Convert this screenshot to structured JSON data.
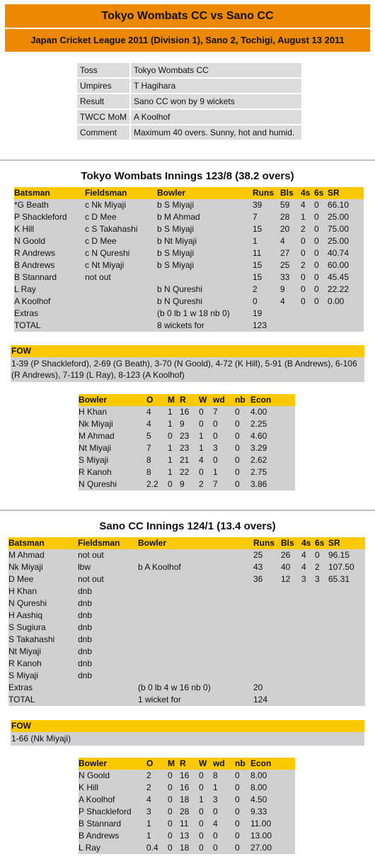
{
  "header": {
    "title": "Tokyo Wombats CC vs Sano CC",
    "subtitle": "Japan Cricket League 2011 (Division 1), Sano 2, Tochigi, August 13 2011"
  },
  "match_info": [
    {
      "key": "Toss",
      "value": "Tokyo Wombats CC"
    },
    {
      "key": "Umpires",
      "value": "T Hagihara"
    },
    {
      "key": "Result",
      "value": "Sano CC won by 9 wickets"
    },
    {
      "key": "TWCC MoM",
      "value": "A Koolhof"
    },
    {
      "key": "Comment",
      "value": "Maximum 40 overs. Sunny, hot and humid."
    }
  ],
  "colors": {
    "banner": "#ec8800",
    "table_header": "#fcc800",
    "row_bg": "#d0d0d0",
    "info_bg": "#dcdcdc"
  },
  "batting_headers": [
    "Batsman",
    "Fieldsman",
    "Bowler",
    "Runs",
    "Bls",
    "4s",
    "6s",
    "SR"
  ],
  "bowling_headers": [
    "Bowler",
    "O",
    "M",
    "R",
    "W",
    "wd",
    "nb",
    "Econ"
  ],
  "fow_label": "FOW",
  "innings1": {
    "title": "Tokyo Wombats Innings 123/8 (38.2 overs)",
    "batting": [
      [
        "*G Beath",
        "c Nk Miyaji",
        "b S Miyaji",
        "39",
        "59",
        "4",
        "0",
        "66.10"
      ],
      [
        "P Shackleford",
        "c D Mee",
        "b M Ahmad",
        "7",
        "28",
        "1",
        "0",
        "25.00"
      ],
      [
        "K Hill",
        "c S Takahashi",
        "b S Miyaji",
        "15",
        "20",
        "2",
        "0",
        "75.00"
      ],
      [
        "N Goold",
        "c D Mee",
        "b Nt Miyaji",
        "1",
        "4",
        "0",
        "0",
        "25.00"
      ],
      [
        "R Andrews",
        "c N Qureshi",
        "b S Miyaji",
        "11",
        "27",
        "0",
        "0",
        "40.74"
      ],
      [
        "B Andrews",
        "c Nt Miyaji",
        "b S Miyaji",
        "15",
        "25",
        "2",
        "0",
        "60.00"
      ],
      [
        "B Stannard",
        "not out",
        "",
        "15",
        "33",
        "0",
        "0",
        "45.45"
      ],
      [
        "L Ray",
        "",
        "b N Qureshi",
        "2",
        "9",
        "0",
        "0",
        "22.22"
      ],
      [
        "A Koolhof",
        "",
        "b N Qureshi",
        "0",
        "4",
        "0",
        "0",
        "0.00"
      ],
      [
        "Extras",
        "",
        "(b 0 lb 1 w 18 nb 0)",
        "19",
        "",
        "",
        "",
        ""
      ],
      [
        "TOTAL",
        "",
        "8 wickets for",
        "123",
        "",
        "",
        "",
        ""
      ]
    ],
    "fow": "1-39 (P Shackleford), 2-69 (G Beath), 3-70 (N Goold), 4-72 (K Hill), 5-91 (B Andrews), 6-106 (R Andrews), 7-119 (L Ray), 8-123 (A Koolhof)",
    "bowling": [
      [
        "H Khan",
        "4",
        "1",
        "16",
        "0",
        "7",
        "0",
        "4.00"
      ],
      [
        "Nk Miyaji",
        "4",
        "1",
        "9",
        "0",
        "0",
        "0",
        "2.25"
      ],
      [
        "M Ahmad",
        "5",
        "0",
        "23",
        "1",
        "0",
        "0",
        "4.60"
      ],
      [
        "Nt Miyaji",
        "7",
        "1",
        "23",
        "1",
        "3",
        "0",
        "3.29"
      ],
      [
        "S Miyaji",
        "8",
        "1",
        "21",
        "4",
        "0",
        "0",
        "2.62"
      ],
      [
        "R Kanoh",
        "8",
        "1",
        "22",
        "0",
        "1",
        "0",
        "2.75"
      ],
      [
        "N Qureshi",
        "2.2",
        "0",
        "9",
        "2",
        "7",
        "0",
        "3.86"
      ]
    ]
  },
  "innings2": {
    "title": "Sano CC Innings 124/1 (13.4 overs)",
    "batting": [
      [
        "M Ahmad",
        "not out",
        "",
        "25",
        "26",
        "4",
        "0",
        "96.15"
      ],
      [
        "Nk Miyaji",
        "lbw",
        "b A Koolhof",
        "43",
        "40",
        "4",
        "2",
        "107.50"
      ],
      [
        "D Mee",
        "not out",
        "",
        "36",
        "12",
        "3",
        "3",
        "65.31"
      ],
      [
        "H Khan",
        "dnb",
        "",
        "",
        "",
        "",
        "",
        ""
      ],
      [
        "N Qureshi",
        "dnb",
        "",
        "",
        "",
        "",
        "",
        ""
      ],
      [
        "H Aashiq",
        "dnb",
        "",
        "",
        "",
        "",
        "",
        ""
      ],
      [
        "S Sugiura",
        "dnb",
        "",
        "",
        "",
        "",
        "",
        ""
      ],
      [
        "S Takahashi",
        "dnb",
        "",
        "",
        "",
        "",
        "",
        ""
      ],
      [
        "Nt Miyaji",
        "dnb",
        "",
        "",
        "",
        "",
        "",
        ""
      ],
      [
        "R Kanoh",
        "dnb",
        "",
        "",
        "",
        "",
        "",
        ""
      ],
      [
        "S Miyaji",
        "dnb",
        "",
        "",
        "",
        "",
        "",
        ""
      ],
      [
        "Extras",
        "",
        "(b 0 lb 4 w 16 nb 0)",
        "20",
        "",
        "",
        "",
        ""
      ],
      [
        "TOTAL",
        "",
        "1 wicket for",
        "124",
        "",
        "",
        "",
        ""
      ]
    ],
    "fow": "1-66 (Nk Miyaji)",
    "bowling": [
      [
        "N Goold",
        "2",
        "0",
        "16",
        "0",
        "8",
        "0",
        "8.00"
      ],
      [
        "K Hill",
        "2",
        "0",
        "16",
        "0",
        "1",
        "0",
        "8.00"
      ],
      [
        "A Koolhof",
        "4",
        "0",
        "18",
        "1",
        "3",
        "0",
        "4.50"
      ],
      [
        "P Shackleford",
        "3",
        "0",
        "28",
        "0",
        "0",
        "0",
        "9.33"
      ],
      [
        "B Stannard",
        "1",
        "0",
        "11",
        "0",
        "4",
        "0",
        "11.00"
      ],
      [
        "B Andrews",
        "1",
        "0",
        "13",
        "0",
        "0",
        "0",
        "13.00"
      ],
      [
        "L Ray",
        "0.4",
        "0",
        "18",
        "0",
        "0",
        "0",
        "27.00"
      ]
    ]
  }
}
